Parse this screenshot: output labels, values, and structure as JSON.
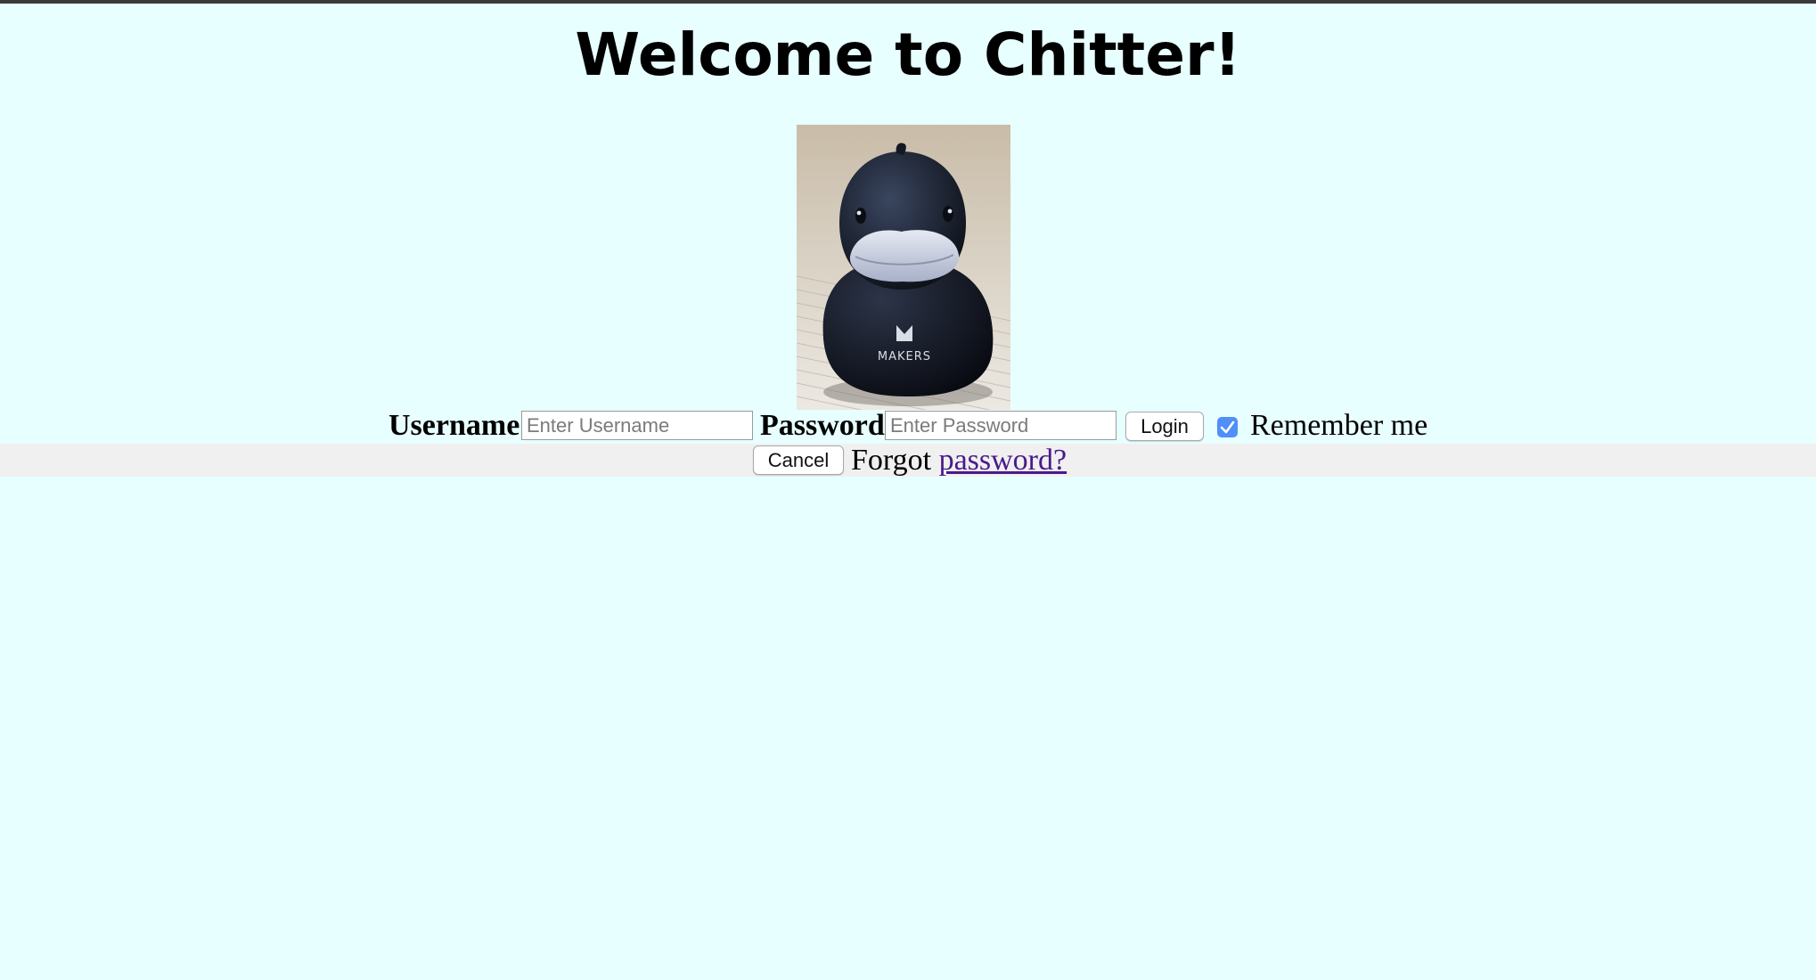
{
  "header": {
    "title": "Welcome to Chitter!"
  },
  "mascot": {
    "icon": "rubber-duck-image",
    "logo_text": "MAKERS"
  },
  "login_form": {
    "username_label": "Username",
    "username_placeholder": "Enter Username",
    "username_value": "",
    "password_label": "Password",
    "password_placeholder": "Enter Password",
    "password_value": "",
    "login_label": "Login",
    "remember_label": "Remember me",
    "remember_checked": true
  },
  "cancel_bar": {
    "cancel_label": "Cancel",
    "forgot_text": "Forgot",
    "password_link": "password?"
  },
  "colors": {
    "background": "#e8ffff",
    "checkbox": "#4f8ff7",
    "link": "#4a1a8a",
    "bar": "#f0f0f0"
  }
}
